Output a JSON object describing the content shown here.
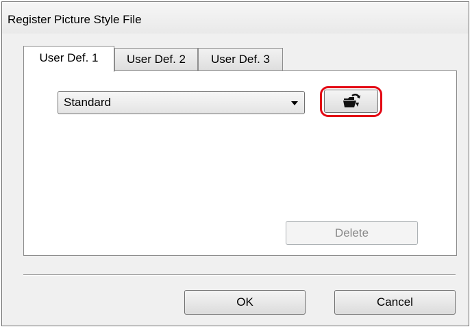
{
  "window": {
    "title": "Register Picture Style File"
  },
  "tabs": [
    {
      "label": "User Def. 1",
      "active": true
    },
    {
      "label": "User Def. 2",
      "active": false
    },
    {
      "label": "User Def. 3",
      "active": false
    }
  ],
  "panel": {
    "style_select": {
      "value": "Standard"
    },
    "load_button": {
      "icon": "open-folder-icon"
    },
    "delete_label": "Delete"
  },
  "buttons": {
    "ok_label": "OK",
    "cancel_label": "Cancel"
  },
  "colors": {
    "highlight": "#e30613"
  }
}
